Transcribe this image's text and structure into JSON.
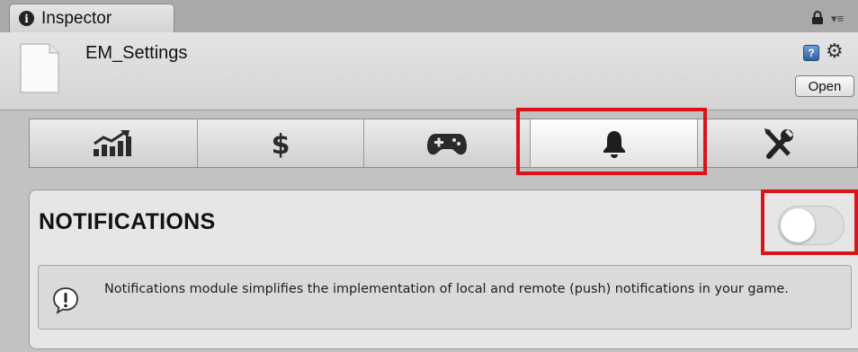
{
  "inspector_tab": {
    "title": "Inspector",
    "info_icon": "info-circle-icon",
    "lock_icon": "lock-icon",
    "menu_icon": "panel-menu-icon"
  },
  "header": {
    "asset_name": "EM_Settings",
    "help_icon": "help-book-icon",
    "settings_icon": "gear-dropdown-icon",
    "open_label": "Open"
  },
  "toolbar": {
    "buttons": [
      {
        "id": "analytics",
        "icon": "growth-chart-icon",
        "active": false
      },
      {
        "id": "monetization",
        "icon": "dollar-icon",
        "active": false
      },
      {
        "id": "gaming",
        "icon": "gamepad-icon",
        "active": false
      },
      {
        "id": "notifications",
        "icon": "bell-icon",
        "active": true
      },
      {
        "id": "utilities",
        "icon": "wrench-screwdriver-icon",
        "active": false
      }
    ]
  },
  "notifications": {
    "title": "NOTIFICATIONS",
    "enabled": false,
    "help_text": "Notifications module simplifies the implementation of local and remote (push) notifications in your game."
  },
  "colors": {
    "highlight": "#d9141b",
    "toolbar_active": "#ffffff",
    "panel_background": "#c2c2c2"
  }
}
